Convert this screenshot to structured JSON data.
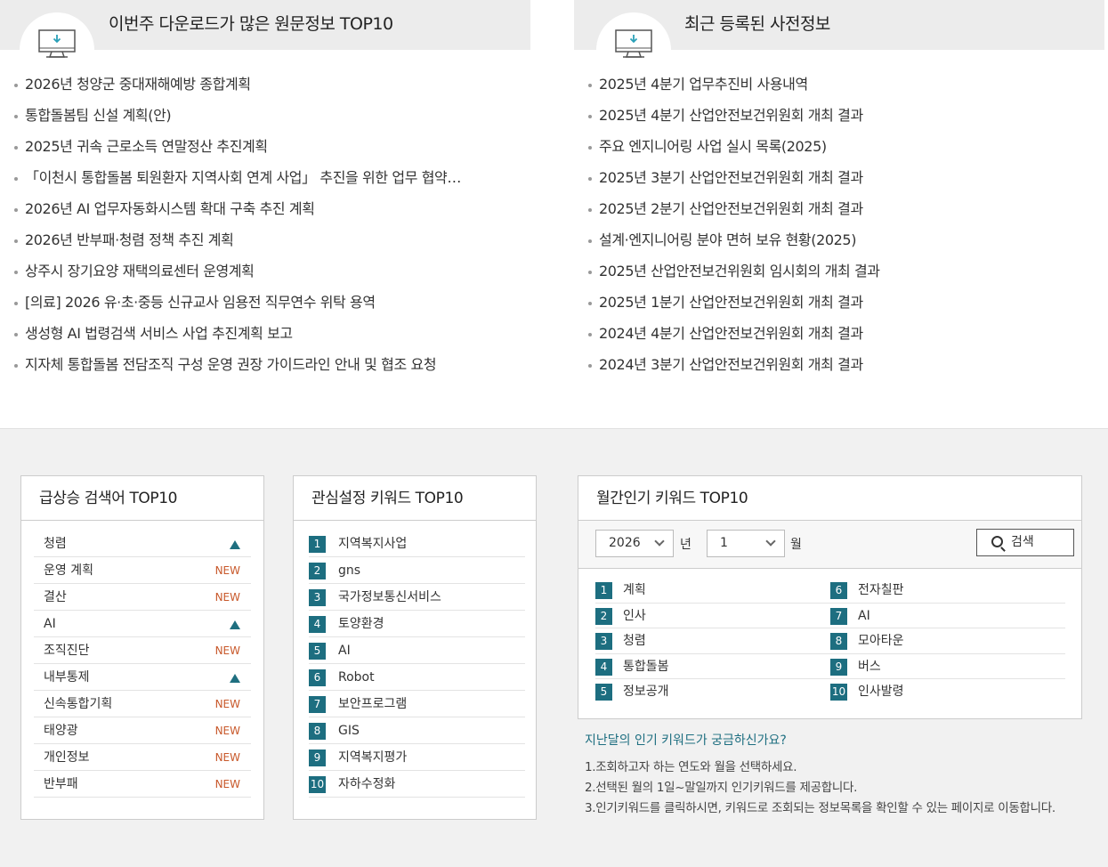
{
  "popular_downloads": {
    "title": "이번주 다운로드가 많은 원문정보 TOP10",
    "icon": "download-monitor-icon",
    "items": [
      "2026년 청양군 중대재해예방 종합계획",
      "통합돌봄팀 신설 계획(안)",
      "2025년 귀속 근로소득 연말정산 추진계획",
      "「이천시 통합돌봄 퇴원환자 지역사회 연계 사업」 추진을 위한 업무 협약…",
      "2026년 AI 업무자동화시스템 확대 구축 추진 계획",
      "2026년 반부패·청렴 정책 추진 계획",
      "상주시 장기요양 재택의료센터 운영계획",
      "[의료] 2026 유·초·중등 신규교사 임용전 직무연수 위탁 용역",
      "생성형 AI 법령검색 서비스 사업 추진계획 보고",
      "지자체 통합돌봄 전담조직 구성 운영 권장 가이드라인 안내 및 협조 요청"
    ]
  },
  "recent_info": {
    "title": "최근 등록된 사전정보",
    "icon": "download-monitor-icon",
    "items": [
      "2025년 4분기 업무추진비 사용내역",
      "2025년 4분기 산업안전보건위원회 개최 결과",
      "주요 엔지니어링 사업 실시 목록(2025)",
      "2025년 3분기 산업안전보건위원회 개최 결과",
      "2025년 2분기 산업안전보건위원회 개최 결과",
      "설계·엔지니어링 분야 면허 보유 현황(2025)",
      "2025년 산업안전보건위원회 임시회의 개최 결과",
      "2025년 1분기 산업안전보건위원회 개최 결과",
      "2024년 4분기 산업안전보건위원회 개최 결과",
      "2024년 3분기 산업안전보건위원회 개최 결과"
    ]
  },
  "rising_keywords": {
    "title": "급상승 검색어 TOP10",
    "new_label": "NEW",
    "colors": {
      "new": "#c8582a",
      "up": "#1f6f80"
    },
    "items": [
      {
        "label": "청렴",
        "status": "up"
      },
      {
        "label": "운영 계획",
        "status": "new"
      },
      {
        "label": "결산",
        "status": "new"
      },
      {
        "label": "AI",
        "status": "up"
      },
      {
        "label": "조직진단",
        "status": "new"
      },
      {
        "label": "내부통제",
        "status": "up"
      },
      {
        "label": "신속통합기획",
        "status": "new"
      },
      {
        "label": "태양광",
        "status": "new"
      },
      {
        "label": "개인정보",
        "status": "new"
      },
      {
        "label": "반부패",
        "status": "new"
      }
    ]
  },
  "interest_keywords": {
    "title": "관심설정 키워드 TOP10",
    "items": [
      {
        "rank": "1",
        "label": "지역복지사업"
      },
      {
        "rank": "2",
        "label": "gns"
      },
      {
        "rank": "3",
        "label": "국가정보통신서비스"
      },
      {
        "rank": "4",
        "label": "토양환경"
      },
      {
        "rank": "5",
        "label": "AI"
      },
      {
        "rank": "6",
        "label": "Robot"
      },
      {
        "rank": "7",
        "label": "보안프로그램"
      },
      {
        "rank": "8",
        "label": "GIS"
      },
      {
        "rank": "9",
        "label": "지역복지평가"
      },
      {
        "rank": "10",
        "label": "자하수정화"
      }
    ]
  },
  "monthly_keywords": {
    "title": "월간인기 키워드 TOP10",
    "year_value": "2026",
    "year_label": "년",
    "month_value": "1",
    "month_label": "월",
    "search_label": "검색",
    "accent": "#1d6e80",
    "col1": [
      {
        "rank": "1",
        "label": "계획"
      },
      {
        "rank": "2",
        "label": "인사"
      },
      {
        "rank": "3",
        "label": "청렴"
      },
      {
        "rank": "4",
        "label": "통합돌봄"
      },
      {
        "rank": "5",
        "label": "정보공개"
      }
    ],
    "col2": [
      {
        "rank": "6",
        "label": "전자칠판"
      },
      {
        "rank": "7",
        "label": "AI"
      },
      {
        "rank": "8",
        "label": "모아타운"
      },
      {
        "rank": "9",
        "label": "버스"
      },
      {
        "rank": "10",
        "label": "인사발령"
      }
    ]
  },
  "help": {
    "question": "지난달의 인기 키워드가 궁금하신가요?",
    "lines": [
      "1.조회하고자 하는 연도와 월을 선택하세요.",
      "2.선택된 월의 1일~말일까지 인기키워드를 제공합니다.",
      "3.인기키워드를 클릭하시면, 키워드로 조회되는 정보목록을 확인할 수 있는 페이지로 이동합니다."
    ]
  }
}
